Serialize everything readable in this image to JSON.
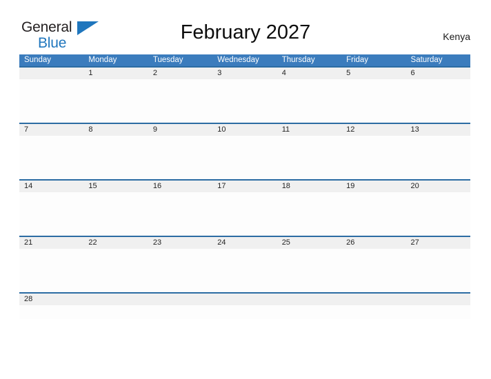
{
  "brand": {
    "name_part1": "General",
    "name_part2": "Blue",
    "flag_icon": "blue-triangle-flag",
    "color_dark": "#231f20",
    "color_blue": "#1f76bd"
  },
  "header": {
    "title": "February 2027",
    "country": "Kenya"
  },
  "theme": {
    "header_blue": "#3b7cbd",
    "row_divider_blue": "#2b6ca3",
    "date_band_gray": "#f0f0f0",
    "page_background": "#ffffff"
  },
  "calendar": {
    "month": "February",
    "year": "2027",
    "weekday_headers": [
      "Sunday",
      "Monday",
      "Tuesday",
      "Wednesday",
      "Thursday",
      "Friday",
      "Saturday"
    ],
    "weeks": [
      {
        "days": [
          "",
          "1",
          "2",
          "3",
          "4",
          "5",
          "6"
        ]
      },
      {
        "days": [
          "7",
          "8",
          "9",
          "10",
          "11",
          "12",
          "13"
        ]
      },
      {
        "days": [
          "14",
          "15",
          "16",
          "17",
          "18",
          "19",
          "20"
        ]
      },
      {
        "days": [
          "21",
          "22",
          "23",
          "24",
          "25",
          "26",
          "27"
        ]
      },
      {
        "days": [
          "28",
          "",
          "",
          "",
          "",
          "",
          ""
        ]
      }
    ]
  }
}
